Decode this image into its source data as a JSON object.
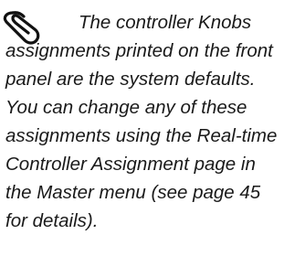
{
  "note": {
    "icon": "paperclip-icon",
    "lines": [
      "The controller Knobs",
      "assignments printed on the front",
      "panel are the system defaults.",
      "You can change any of these",
      "assignments using the Real-time",
      "Controller Assignment page in",
      "the Master menu (see page 45",
      "for details)."
    ]
  }
}
